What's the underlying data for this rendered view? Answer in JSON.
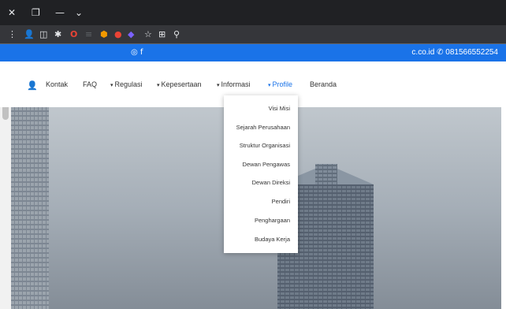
{
  "browser": {
    "window_controls": {
      "close": "✕",
      "restore": "❐",
      "minimize": "—",
      "menu": "⌄"
    },
    "toolbar": {
      "menu": "⋮",
      "profile": "👤",
      "split": "◫",
      "puzzle": "✱",
      "ext1": "O",
      "ext2": "≡",
      "ext3": "⬢",
      "ext4": "●",
      "ext5": "◆",
      "star": "☆",
      "install": "⊞",
      "search": "⚲"
    }
  },
  "page": {
    "topbar": {
      "social_icons": "◎  f",
      "phone_icon": "✆",
      "phone_text": "c.co.id  ✆ 081566552254"
    },
    "navbar": {
      "user_icon": "👤",
      "items": [
        {
          "label": "Beranda"
        },
        {
          "label": "Profile"
        },
        {
          "label": "Informasi"
        },
        {
          "label": "Kepesertaan"
        },
        {
          "label": "Regulasi"
        },
        {
          "label": "FAQ"
        },
        {
          "label": "Kontak"
        }
      ],
      "caret": "▾"
    },
    "dropdown": {
      "items": [
        "Visi Misi",
        "Sejarah Perusahaan",
        "Struktur Organisasi",
        "Dewan Pengawas",
        "Dewan Direksi",
        "Pendiri",
        "Penghargaan",
        "Budaya Kerja"
      ]
    }
  },
  "colors": {
    "accent": "#1a73e8",
    "chrome_dark": "#202124",
    "chrome_toolbar": "#35363a"
  }
}
